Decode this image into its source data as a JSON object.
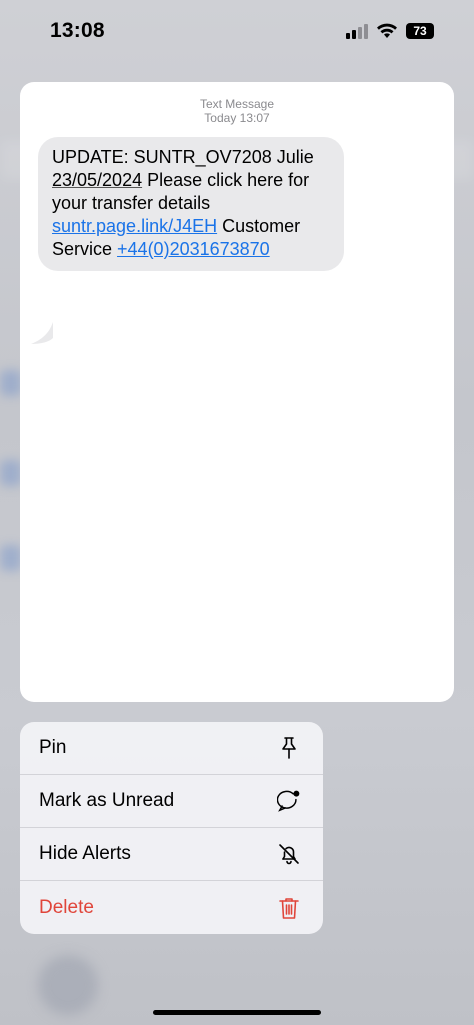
{
  "status_bar": {
    "time": "13:08",
    "battery": "73"
  },
  "message": {
    "sender_label": "Text Message",
    "timestamp": "Today 13:07",
    "body": {
      "line1": "UPDATE: SUNTR_OV7208 Julie",
      "date_text": "23/05/2024",
      "line2_rest": " Please click here for",
      "line3": "your transfer details",
      "link_text": "suntr.page.link/J4EH",
      "after_link": " Customer",
      "service_text": "Service ",
      "phone_text": "+44(0)2031673870"
    }
  },
  "menu": {
    "items": [
      {
        "label": "Pin",
        "icon": "pin-icon"
      },
      {
        "label": "Mark as Unread",
        "icon": "unread-bubble-icon"
      },
      {
        "label": "Hide Alerts",
        "icon": "bell-slash-icon"
      },
      {
        "label": "Delete",
        "icon": "trash-icon",
        "destructive": true
      }
    ]
  },
  "colors": {
    "link": "#1a73e8",
    "destructive": "#e0453a",
    "bubble": "#e9e9eb"
  }
}
